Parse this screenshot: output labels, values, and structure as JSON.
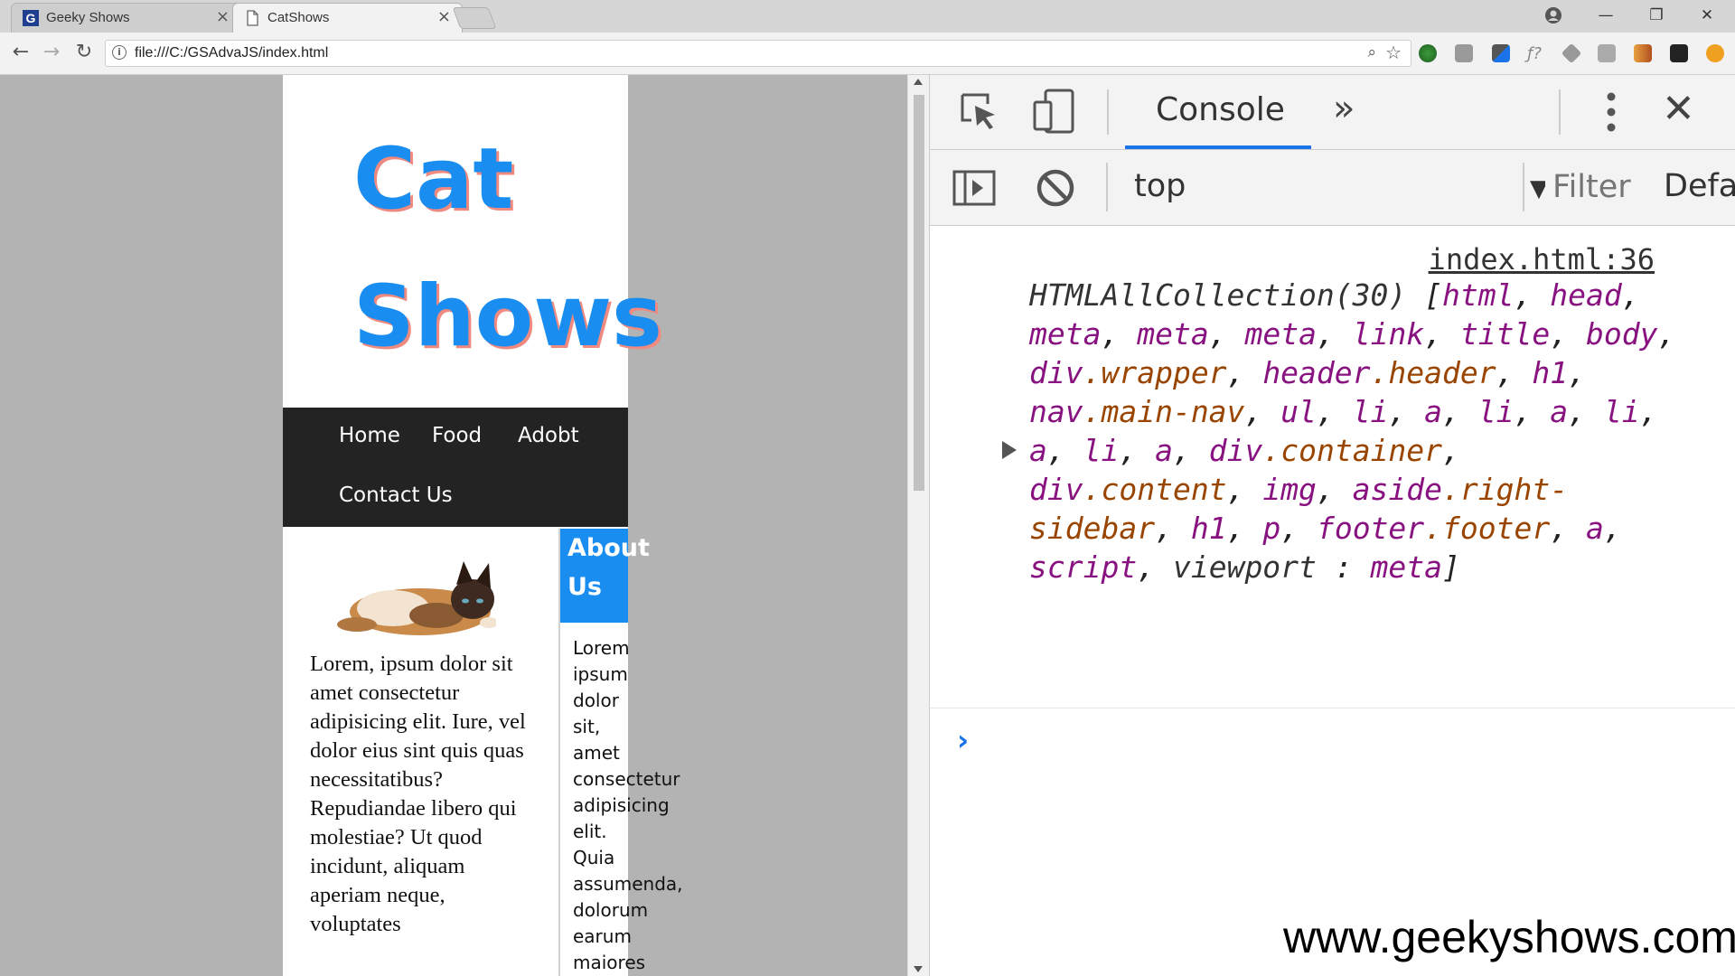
{
  "browser": {
    "tabs": [
      {
        "title": "Geeky Shows",
        "active": false,
        "icon": "geeky-shows-favicon"
      },
      {
        "title": "CatShows",
        "active": true,
        "icon": "page-icon"
      }
    ],
    "tab_close_glyph": "×",
    "url": "file:///C:/GSAdvaJS/index.html"
  },
  "page": {
    "site_title_line1": "Cat",
    "site_title_line2": "Shows",
    "nav": [
      "Home",
      "Food",
      "Adobt",
      "Contact Us"
    ],
    "content_text": "Lorem, ipsum dolor sit amet consectetur adipisicing elit. Iure, vel dolor eius sint quis quas necessitatibus? Repudiandae libero qui molestiae? Ut quod incidunt, aliquam aperiam neque, voluptates",
    "sidebar_heading_line1": "About",
    "sidebar_heading_line2": "Us",
    "sidebar_words": [
      "Lorem",
      "ipsum",
      "dolor",
      "sit,",
      "amet",
      "consectetur",
      "adipisicing",
      "elit.",
      "Quia",
      "assumenda,",
      "dolorum",
      "earum",
      "maiores"
    ],
    "colors": {
      "brand_blue": "#1a8ef0",
      "nav_bg": "#232323",
      "title_shadow": "#f08a80"
    }
  },
  "devtools": {
    "tabs": {
      "console": "Console",
      "more": "»"
    },
    "context": "top",
    "filter_placeholder": "Filter",
    "levels": "Defa",
    "log_source": "index.html:36",
    "log": {
      "collection": "HTMLAllCollection(30)",
      "open_bracket": " [",
      "items": [
        {
          "text": "html",
          "kind": "el"
        },
        {
          "text": "head",
          "kind": "el"
        },
        {
          "text": "meta",
          "kind": "el"
        },
        {
          "text": "meta",
          "kind": "el"
        },
        {
          "text": "meta",
          "kind": "el"
        },
        {
          "text": "link",
          "kind": "el"
        },
        {
          "text": "title",
          "kind": "el"
        },
        {
          "text": "body",
          "kind": "el"
        },
        {
          "text": "div",
          "cls": ".wrapper"
        },
        {
          "text": "header",
          "cls": ".header"
        },
        {
          "text": "h1",
          "kind": "el"
        },
        {
          "text": "nav",
          "cls": ".main-nav"
        },
        {
          "text": "ul",
          "kind": "el"
        },
        {
          "text": "li",
          "kind": "el"
        },
        {
          "text": "a",
          "kind": "el"
        },
        {
          "text": "li",
          "kind": "el"
        },
        {
          "text": "a",
          "kind": "el"
        },
        {
          "text": "li",
          "kind": "el"
        },
        {
          "text": "a",
          "kind": "el"
        },
        {
          "text": "li",
          "kind": "el"
        },
        {
          "text": "a",
          "kind": "el"
        },
        {
          "text": "div",
          "cls": ".container"
        },
        {
          "text": "div",
          "cls": ".content"
        },
        {
          "text": "img",
          "kind": "el"
        },
        {
          "text": "aside",
          "cls": ".right-sidebar"
        },
        {
          "text": "h1",
          "kind": "el"
        },
        {
          "text": "p",
          "kind": "el"
        },
        {
          "text": "footer",
          "cls": ".footer"
        },
        {
          "text": "a",
          "kind": "el"
        },
        {
          "text": "script",
          "kind": "el"
        }
      ],
      "named_key": "viewport",
      "named_sep": " : ",
      "named_value": "meta",
      "close_bracket": "]"
    }
  },
  "watermark": "www.geekyshows.com"
}
